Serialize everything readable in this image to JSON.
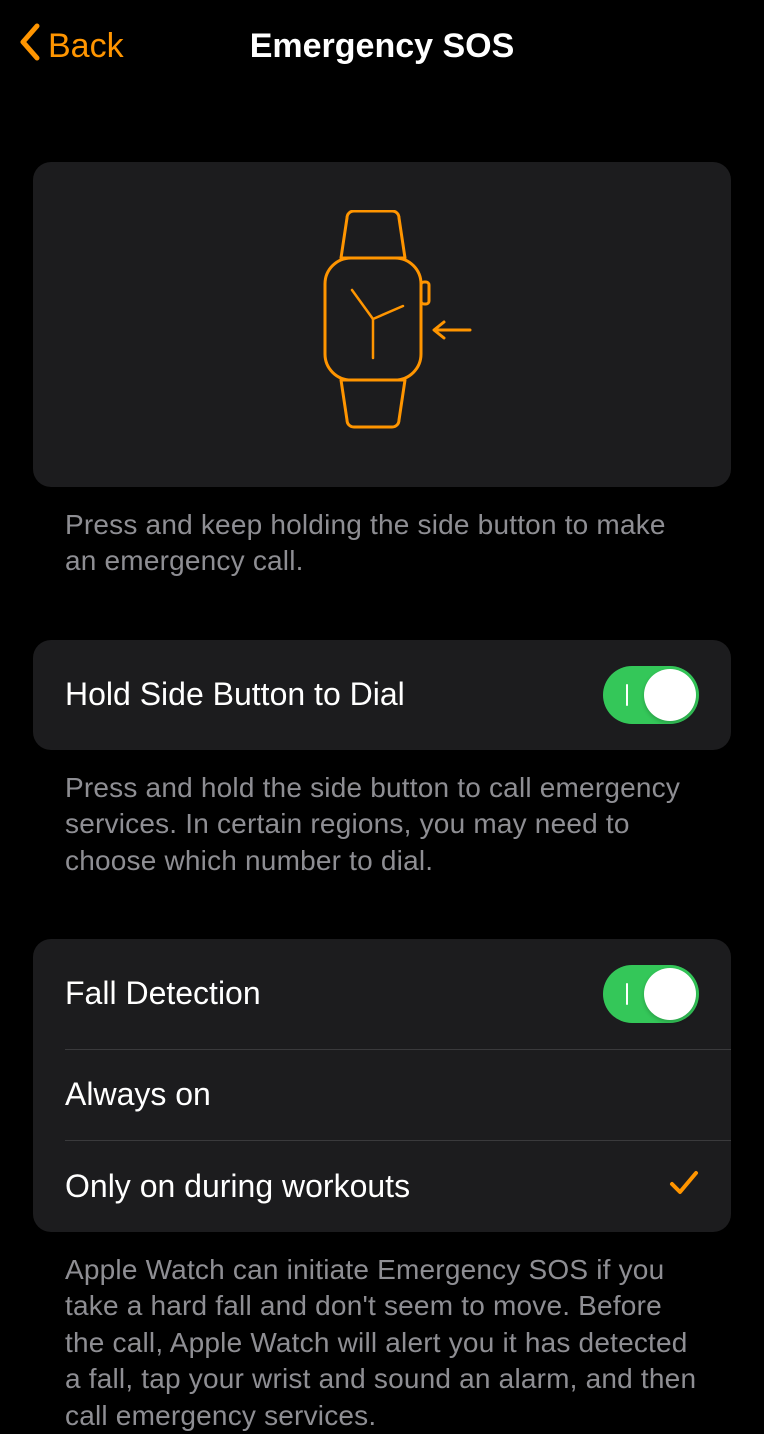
{
  "navbar": {
    "back_label": "Back",
    "title": "Emergency SOS"
  },
  "hero": {
    "instruction": "Press and keep holding the side button to make an emergency call."
  },
  "hold_group": {
    "label": "Hold Side Button to Dial",
    "enabled": true,
    "footer": "Press and hold the side button to call emergency services. In certain regions, you may need to choose which number to dial."
  },
  "fall_group": {
    "toggle_label": "Fall Detection",
    "toggle_enabled": true,
    "option_always": "Always on",
    "option_workouts": "Only on during workouts",
    "selected": "workouts",
    "footer": "Apple Watch can initiate Emergency SOS if you take a hard fall and don't seem to move. Before the call, Apple Watch will alert you it has detected a fall, tap your wrist and sound an alarm, and then call emergency services."
  },
  "colors": {
    "accent": "#FF9500",
    "toggle_on": "#34C759",
    "cell_bg": "#1C1C1E",
    "secondary_text": "#8E8E93"
  }
}
